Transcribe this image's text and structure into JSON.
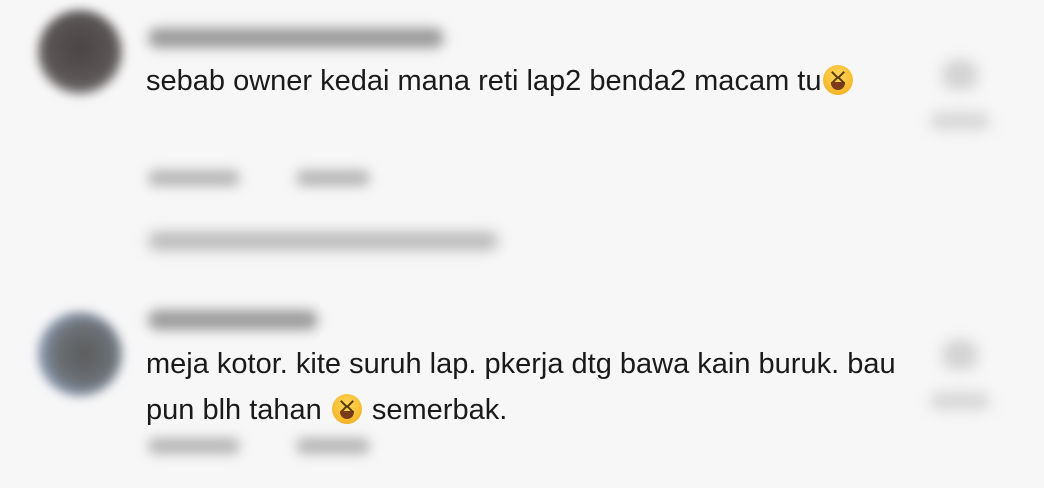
{
  "comments": [
    {
      "text_before": "sebab owner kedai mana reti lap2 benda2 macam tu",
      "text_after": "",
      "emoji": "grinning-squinting-face"
    },
    {
      "text_before": "meja kotor. kite suruh lap. pkerja dtg bawa kain buruk. bau pun blh tahan ",
      "text_after": " semerbak.",
      "emoji": "grinning-squinting-face"
    }
  ]
}
